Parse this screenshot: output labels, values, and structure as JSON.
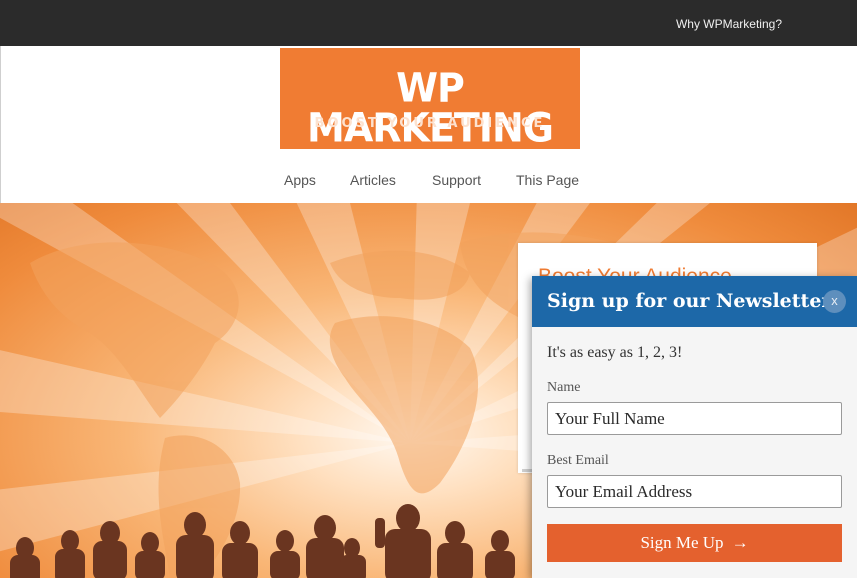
{
  "topbar": {
    "link_label": "Why WPMarketing?"
  },
  "logo": {
    "title": "WP MARKETING",
    "subtitle": "BOOST YOUR AUDIENCE",
    "bg_color": "#f07c33"
  },
  "nav": {
    "items": [
      {
        "label": "Apps"
      },
      {
        "label": "Articles"
      },
      {
        "label": "Support"
      },
      {
        "label": "This Page"
      }
    ]
  },
  "side_card": {
    "title": "Boost Your Audience"
  },
  "popup": {
    "title": "Sign up for our Newsletter",
    "close_label": "x",
    "intro": "It's as easy as 1, 2, 3!",
    "name_label": "Name",
    "name_placeholder": "Your Full Name",
    "email_label": "Best Email",
    "email_placeholder": "Your Email Address",
    "submit_label": "Sign Me Up",
    "submit_arrow": "→",
    "header_color": "#1d68a8",
    "button_color": "#e4612e"
  }
}
